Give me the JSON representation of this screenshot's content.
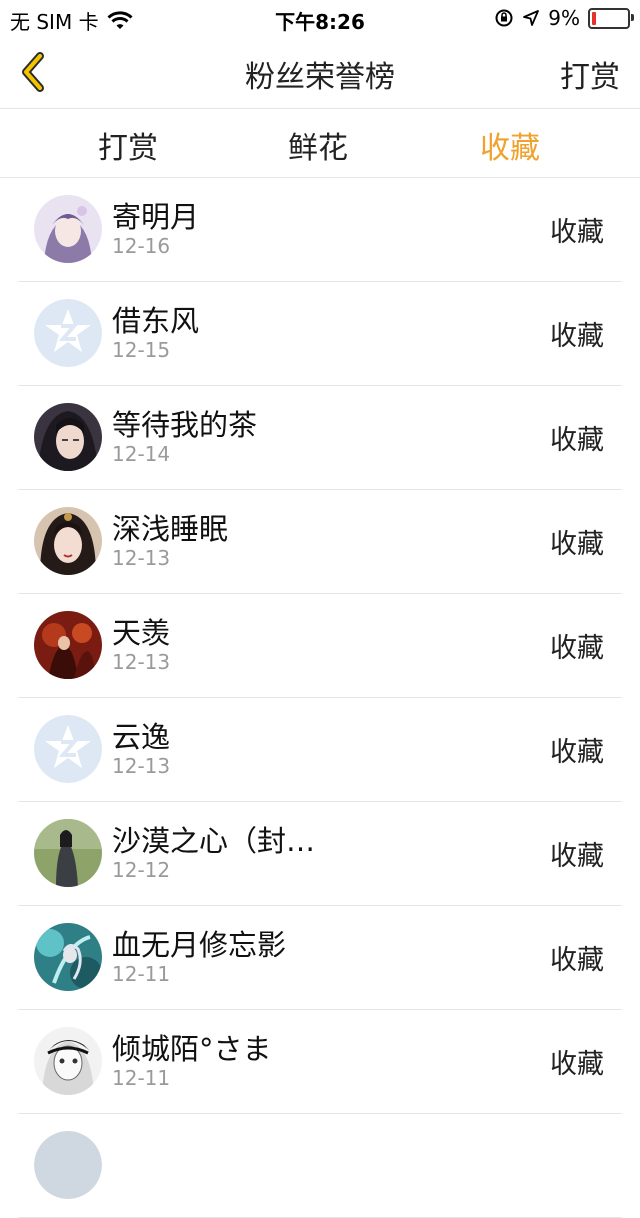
{
  "status_bar": {
    "carrier": "无 SIM 卡",
    "time": "下午8:26",
    "battery": "9%",
    "icons": [
      "wifi-icon",
      "orientation-lock-icon",
      "location-arrow-icon",
      "battery-icon"
    ],
    "battery_color": "#e5322d"
  },
  "nav": {
    "back_icon": "chevron-left-icon",
    "title": "粉丝荣誉榜",
    "right_label": "打赏",
    "accent": "#f0a22e"
  },
  "tabs": [
    {
      "label": "打赏",
      "active": false
    },
    {
      "label": "鲜花",
      "active": false
    },
    {
      "label": "收藏",
      "active": true
    }
  ],
  "rows": [
    {
      "name": "寄明月",
      "date": "12-16",
      "action": "收藏",
      "avatar": "anime-girl-avatar"
    },
    {
      "name": "借东风",
      "date": "12-15",
      "action": "收藏",
      "avatar": "default-star-avatar"
    },
    {
      "name": "等待我的茶",
      "date": "12-14",
      "action": "收藏",
      "avatar": "portrait-avatar"
    },
    {
      "name": "深浅睡眠",
      "date": "12-13",
      "action": "收藏",
      "avatar": "portrait-avatar"
    },
    {
      "name": "天羡",
      "date": "12-13",
      "action": "收藏",
      "avatar": "red-art-avatar"
    },
    {
      "name": "云逸",
      "date": "12-13",
      "action": "收藏",
      "avatar": "default-star-avatar"
    },
    {
      "name": "沙漠之心（封…",
      "date": "12-12",
      "action": "收藏",
      "avatar": "photo-avatar"
    },
    {
      "name": "血无月修忘影",
      "date": "12-11",
      "action": "收藏",
      "avatar": "teal-art-avatar"
    },
    {
      "name": "倾城陌°さま",
      "date": "12-11",
      "action": "收藏",
      "avatar": "sketch-avatar"
    }
  ]
}
